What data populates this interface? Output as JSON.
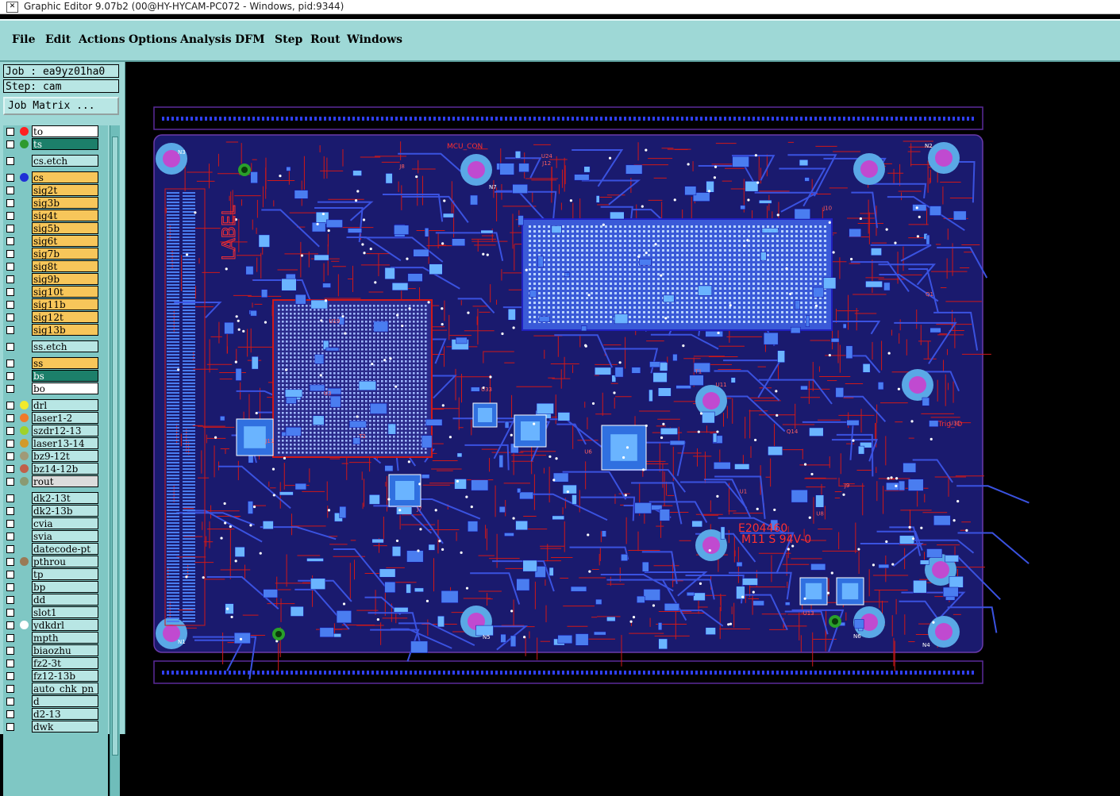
{
  "window": {
    "title": "Graphic Editor 9.07b2 (00@HY-HYCAM-PC072 - Windows, pid:9344)",
    "icon": "app-icon"
  },
  "menu": [
    "File",
    "Edit",
    "Actions",
    "Options",
    "Analysis",
    "DFM",
    "Step",
    "Rout",
    "Windows"
  ],
  "job": {
    "label": "Job : ea9yz01ha0",
    "step": "Step: cam",
    "matrix_button": "Job Matrix ..."
  },
  "layers": [
    {
      "name": "to",
      "bg": "#ffffff",
      "dot": "#ff2020"
    },
    {
      "name": "ts",
      "bg": "#1c7f6a",
      "dot": "#2e9a2e",
      "fg": "#ffffff"
    },
    {
      "name": "cs.etch",
      "bg": "#b8e6e4",
      "dot": ""
    },
    {
      "name": "cs",
      "bg": "#f7c65a",
      "dot": "#1f2fd6"
    },
    {
      "name": "sig2t",
      "bg": "#f7c65a",
      "dot": ""
    },
    {
      "name": "sig3b",
      "bg": "#f7c65a",
      "dot": ""
    },
    {
      "name": "sig4t",
      "bg": "#f7c65a",
      "dot": ""
    },
    {
      "name": "sig5b",
      "bg": "#f7c65a",
      "dot": ""
    },
    {
      "name": "sig6t",
      "bg": "#f7c65a",
      "dot": ""
    },
    {
      "name": "sig7b",
      "bg": "#f7c65a",
      "dot": ""
    },
    {
      "name": "sig8t",
      "bg": "#f7c65a",
      "dot": ""
    },
    {
      "name": "sig9b",
      "bg": "#f7c65a",
      "dot": ""
    },
    {
      "name": "sig10t",
      "bg": "#f7c65a",
      "dot": ""
    },
    {
      "name": "sig11b",
      "bg": "#f7c65a",
      "dot": ""
    },
    {
      "name": "sig12t",
      "bg": "#f7c65a",
      "dot": ""
    },
    {
      "name": "sig13b",
      "bg": "#f7c65a",
      "dot": ""
    },
    {
      "name": "ss.etch",
      "bg": "#b8e6e4",
      "dot": ""
    },
    {
      "name": "ss",
      "bg": "#f7c65a",
      "dot": ""
    },
    {
      "name": "bs",
      "bg": "#1c7f6a",
      "dot": "",
      "fg": "#ffffff"
    },
    {
      "name": "bo",
      "bg": "#ffffff",
      "dot": ""
    },
    {
      "name": "drl",
      "bg": "#b8e6e4",
      "dot": "#f2ea2a"
    },
    {
      "name": "laser1-2",
      "bg": "#b8e6e4",
      "dot": "#f07a2a"
    },
    {
      "name": "szdr12-13",
      "bg": "#b8e6e4",
      "dot": "#9fd22a"
    },
    {
      "name": "laser13-14",
      "bg": "#b8e6e4",
      "dot": "#d29a2a"
    },
    {
      "name": "bz9-12t",
      "bg": "#b8e6e4",
      "dot": "#a09a78"
    },
    {
      "name": "bz14-12b",
      "bg": "#b8e6e4",
      "dot": "#c0604a"
    },
    {
      "name": "rout",
      "bg": "#dcdcdc",
      "dot": "#8a9a72"
    },
    {
      "name": "dk2-13t",
      "bg": "#b8e6e4",
      "dot": ""
    },
    {
      "name": "dk2-13b",
      "bg": "#b8e6e4",
      "dot": ""
    },
    {
      "name": "cvia",
      "bg": "#b8e6e4",
      "dot": ""
    },
    {
      "name": "svia",
      "bg": "#b8e6e4",
      "dot": ""
    },
    {
      "name": "datecode-pt",
      "bg": "#b8e6e4",
      "dot": ""
    },
    {
      "name": "pthrou",
      "bg": "#b8e6e4",
      "dot": "#9a7a56"
    },
    {
      "name": "tp",
      "bg": "#b8e6e4",
      "dot": ""
    },
    {
      "name": "bp",
      "bg": "#b8e6e4",
      "dot": ""
    },
    {
      "name": "dd",
      "bg": "#b8e6e4",
      "dot": ""
    },
    {
      "name": "slot1",
      "bg": "#b8e6e4",
      "dot": ""
    },
    {
      "name": "ydkdrl",
      "bg": "#b8e6e4",
      "dot": "#ffffff"
    },
    {
      "name": "mpth",
      "bg": "#b8e6e4",
      "dot": ""
    },
    {
      "name": "biaozhu",
      "bg": "#b8e6e4",
      "dot": ""
    },
    {
      "name": "fz2-3t",
      "bg": "#b8e6e4",
      "dot": ""
    },
    {
      "name": "fz12-13b",
      "bg": "#b8e6e4",
      "dot": ""
    },
    {
      "name": "auto_chk_pn",
      "bg": "#b8e6e4",
      "dot": ""
    },
    {
      "name": "d",
      "bg": "#b8e6e4",
      "dot": ""
    },
    {
      "name": "d2-13",
      "bg": "#b8e6e4",
      "dot": ""
    },
    {
      "name": "dwk",
      "bg": "#b8e6e4",
      "dot": ""
    }
  ],
  "board_text": {
    "label": "LABEL",
    "marking1": "E204460",
    "marking2": "M11 S 94V-0",
    "connector": "MCU_CON",
    "trig": "Trig_IO",
    "holes": [
      "N1",
      "N2",
      "N3",
      "N4",
      "N5",
      "N6",
      "N7"
    ],
    "refs": [
      "U1",
      "U3",
      "U6",
      "U8",
      "U11",
      "U13",
      "U19",
      "U24",
      "U31",
      "U33",
      "J7",
      "J8",
      "J9",
      "J10",
      "J11",
      "J12",
      "Q1",
      "Q14",
      "T1",
      "T2"
    ]
  },
  "colors": {
    "board": "#1a1a6e",
    "trace": "#d01818",
    "pad": "#4a7df0",
    "pad_alt": "#6ab4ff",
    "silk": "#ff3030",
    "via": "#c050d0",
    "pin": "#3040ff"
  }
}
